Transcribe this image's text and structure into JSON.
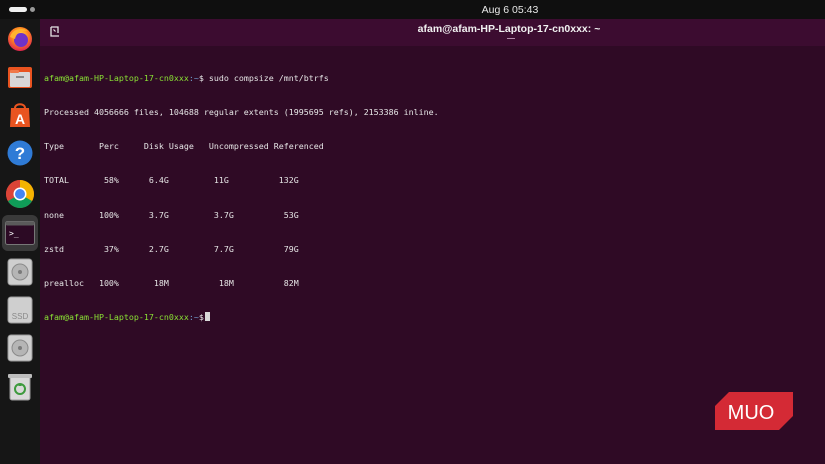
{
  "topbar": {
    "clock": "Aug 6  05:43"
  },
  "dock": {
    "items": [
      {
        "icon": "firefox-icon"
      },
      {
        "icon": "files-icon"
      },
      {
        "icon": "app-center-icon"
      },
      {
        "icon": "help-icon"
      },
      {
        "icon": "chrome-icon"
      },
      {
        "icon": "terminal-icon"
      },
      {
        "icon": "disk-icon"
      },
      {
        "icon": "ssd-icon",
        "label": "SSD"
      },
      {
        "icon": "disk-icon"
      },
      {
        "icon": "trash-icon"
      }
    ]
  },
  "window": {
    "title": "afam@afam-HP-Laptop-17-cn0xxx: ~"
  },
  "terminal": {
    "prompt_user": "afam@afam-HP-Laptop-17-cn0xxx",
    "prompt_path": ":~",
    "prompt_symbol": "$",
    "command": " sudo compsize /mnt/btrfs",
    "lines": [
      "Processed 4056666 files, 104688 regular extents (1995695 refs), 2153386 inline.",
      "Type       Perc     Disk Usage   Uncompressed Referenced",
      "TOTAL       58%      6.4G         11G          132G",
      "none       100%      3.7G         3.7G          53G",
      "zstd        37%      2.7G         7.7G          79G",
      "prealloc   100%       18M          18M          82M"
    ]
  },
  "watermark": {
    "text": "MUO"
  },
  "colors": {
    "terminal_bg": "#2f0a25",
    "titlebar_bg": "#3c0c30",
    "prompt_user": "#8ae234",
    "prompt_path": "#729fcf",
    "watermark_red": "#d42a35"
  }
}
